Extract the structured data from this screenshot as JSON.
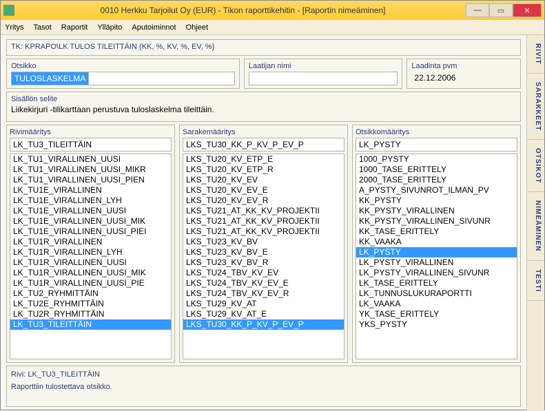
{
  "window": {
    "title": "0010   Herkku Tarjoilut Oy (EUR) - Tikon raporttikehitin - [Raportin nimeäminen]",
    "min": "—",
    "max": "▭",
    "close": "✕"
  },
  "menu": {
    "items": [
      "Yritys",
      "Tasot",
      "Raportit",
      "Ylläpito",
      "Aputoiminnot",
      "Ohjeet"
    ]
  },
  "tk_line": "TK: KPRAPO\\LK TULOS TILEITTÄIN (KK, %, KV, %, EV, %)",
  "otsikko": {
    "label": "Otsikko",
    "value": "TULOSLASKELMA"
  },
  "laatija": {
    "label": "Laatijan nimi",
    "value": ""
  },
  "laadinta": {
    "label": "Laadinta pvm",
    "value": "22.12.2006"
  },
  "sisalto": {
    "label": "Sisällön selite",
    "value": "Liikekirjuri -tilikarttaan perustuva tuloslaskelma tileittäin."
  },
  "rivim": {
    "label": "Rivimääritys",
    "head": "LK_TU3_TILEITTÄIN",
    "items": [
      "LK_TU1_VIRALLINEN_UUSI",
      "LK_TU1_VIRALLINEN_UUSI_MIKR",
      "LK_TU1_VIRALLINEN_UUSI_PIEN",
      "LK_TU1E_VIRALLINEN",
      "LK_TU1E_VIRALLINEN_LYH",
      "LK_TU1E_VIRALLINEN_UUSI",
      "LK_TU1E_VIRALLINEN_UUSI_MIK",
      "LK_TU1E_VIRALLINEN_UUSI_PIEI",
      "LK_TU1R_VIRALLINEN",
      "LK_TU1R_VIRALLINEN_LYH",
      "LK_TU1R_VIRALLINEN_UUSI",
      "LK_TU1R_VIRALLINEN_UUSI_MIK",
      "LK_TU1R_VIRALLINEN_UUSI_PIE",
      "LK_TU2_RYHMITTÄIN",
      "LK_TU2E_RYHMITTÄIN",
      "LK_TU2R_RYHMITTÄIN",
      "LK_TU3_TILEITTÄIN"
    ],
    "selected": "LK_TU3_TILEITTÄIN"
  },
  "sarakem": {
    "label": "Sarakemääritys",
    "head": "LKS_TU30_KK_P_KV_P_EV_P",
    "items": [
      "LKS_TU20_KV_ETP_E",
      "LKS_TU20_KV_ETP_R",
      "LKS_TU20_KV_EV",
      "LKS_TU20_KV_EV_E",
      "LKS_TU20_KV_EV_R",
      "LKS_TU21_AT_KK_KV_PROJEKTII",
      "LKS_TU21_AT_KK_KV_PROJEKTII",
      "LKS_TU21_AT_KK_KV_PROJEKTII",
      "LKS_TU23_KV_BV",
      "LKS_TU23_KV_BV_E",
      "LKS_TU23_KV_BV_R",
      "LKS_TU24_TBV_KV_EV",
      "LKS_TU24_TBV_KV_EV_E",
      "LKS_TU24_TBV_KV_EV_R",
      "LKS_TU29_KV_AT",
      "LKS_TU29_KV_AT_E",
      "LKS_TU30_KK_P_KV_P_EV_P"
    ],
    "selected": "LKS_TU30_KK_P_KV_P_EV_P"
  },
  "otsikom": {
    "label": "Otsikkomääritys",
    "head": "LK_PYSTY",
    "items": [
      "1000_PYSTY",
      "1000_TASE_ERITTELY",
      "2000_TASE_ERITTELY",
      "A_PYSTY_SIVUNROT_ILMAN_PV",
      "KK_PYSTY",
      "KK_PYSTY_VIRALLINEN",
      "KK_PYSTY_VIRALLINEN_SIVUNR",
      "KK_TASE_ERITTELY",
      "KK_VAAKA",
      "LK_PYSTY",
      "LK_PYSTY_VIRALLINEN",
      "LK_PYSTY_VIRALLINEN_SIVUNR",
      "LK_TASE_ERITTELY",
      "LK_TUNNUSLUKURAPORTTI",
      "LK_VAAKA",
      "YK_TASE_ERITTELY",
      "YKS_PYSTY"
    ],
    "selected": "LK_PYSTY"
  },
  "bottom": {
    "line1": "Rivi: LK_TU3_TILEITTÄIN",
    "line2": "Raporttiin tulostettava otsikko."
  },
  "sidetabs": [
    "RIVIT",
    "SARAKKEET",
    "OTSIKOT",
    "NIMEÄMINEN",
    "TESTI"
  ]
}
